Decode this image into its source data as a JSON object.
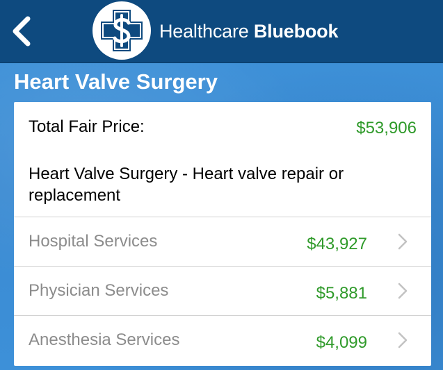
{
  "header": {
    "back_icon": "chevron-left-icon",
    "logo_icon": "dollar-cross-icon",
    "brand_light": "Healthcare ",
    "brand_bold": "Bluebook"
  },
  "page": {
    "title": "Heart Valve Surgery"
  },
  "card": {
    "total_label": "Total Fair Price:",
    "total_value": "$53,906",
    "description": "Heart Valve Surgery - Heart valve repair or replacement",
    "rows": [
      {
        "label": "Hospital Services",
        "value": "$43,927"
      },
      {
        "label": "Physician Services",
        "value": "$5,881"
      },
      {
        "label": "Anesthesia Services",
        "value": "$4,099"
      }
    ]
  },
  "colors": {
    "header_bg": "#0e4a7f",
    "page_bg": "#3d8fd6",
    "price_green": "#2f9a2a",
    "muted_text": "#8c8c8c",
    "logo_blue": "#0e4a7f"
  }
}
